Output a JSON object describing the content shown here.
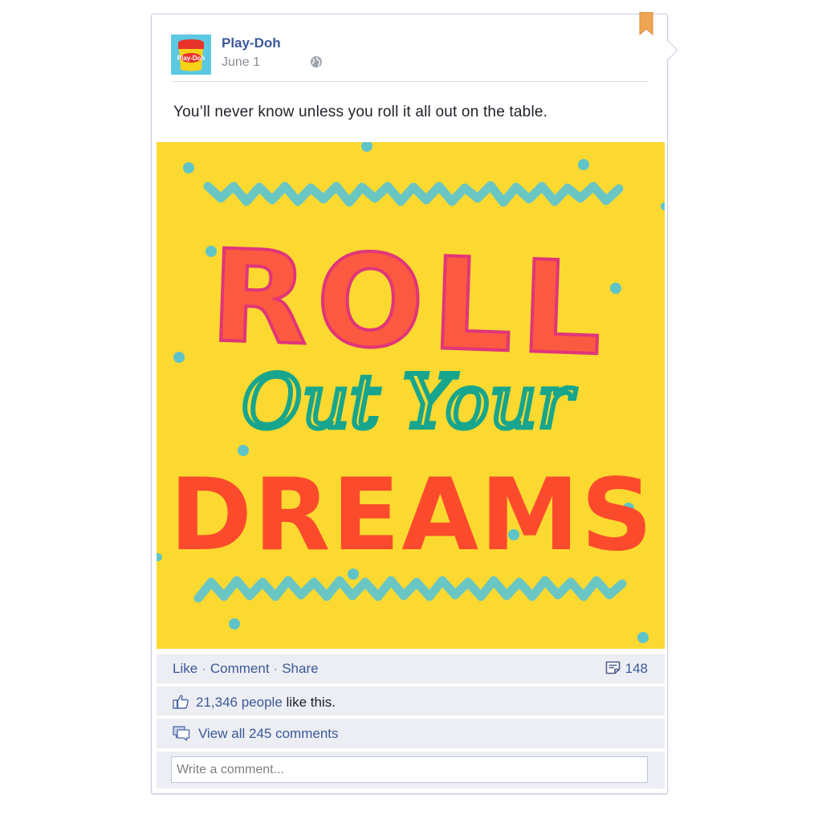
{
  "post": {
    "author": "Play-Doh",
    "date": "June 1",
    "message": "You’ll never know unless you roll it all out on the table.",
    "image": {
      "line1": "ROLL",
      "line2": "Out Your",
      "line3": "DREAMS",
      "avatar_text": "Play-Doh"
    }
  },
  "actions": {
    "like": "Like",
    "comment": "Comment",
    "share": "Share",
    "separator": "·",
    "share_count": "148"
  },
  "likes": {
    "count": "21,346 people",
    "suffix": "like this."
  },
  "comments": {
    "view_all": "View all 245 comments"
  },
  "comment_box": {
    "placeholder": "Write a comment..."
  },
  "colors": {
    "link": "#3b5998",
    "bookmark": "#f0a552",
    "image_background": "#fcd930"
  },
  "icons": [
    "bookmark-icon",
    "globe-icon",
    "share-count-icon",
    "thumbs-up-icon",
    "comment-bubble-icon"
  ]
}
